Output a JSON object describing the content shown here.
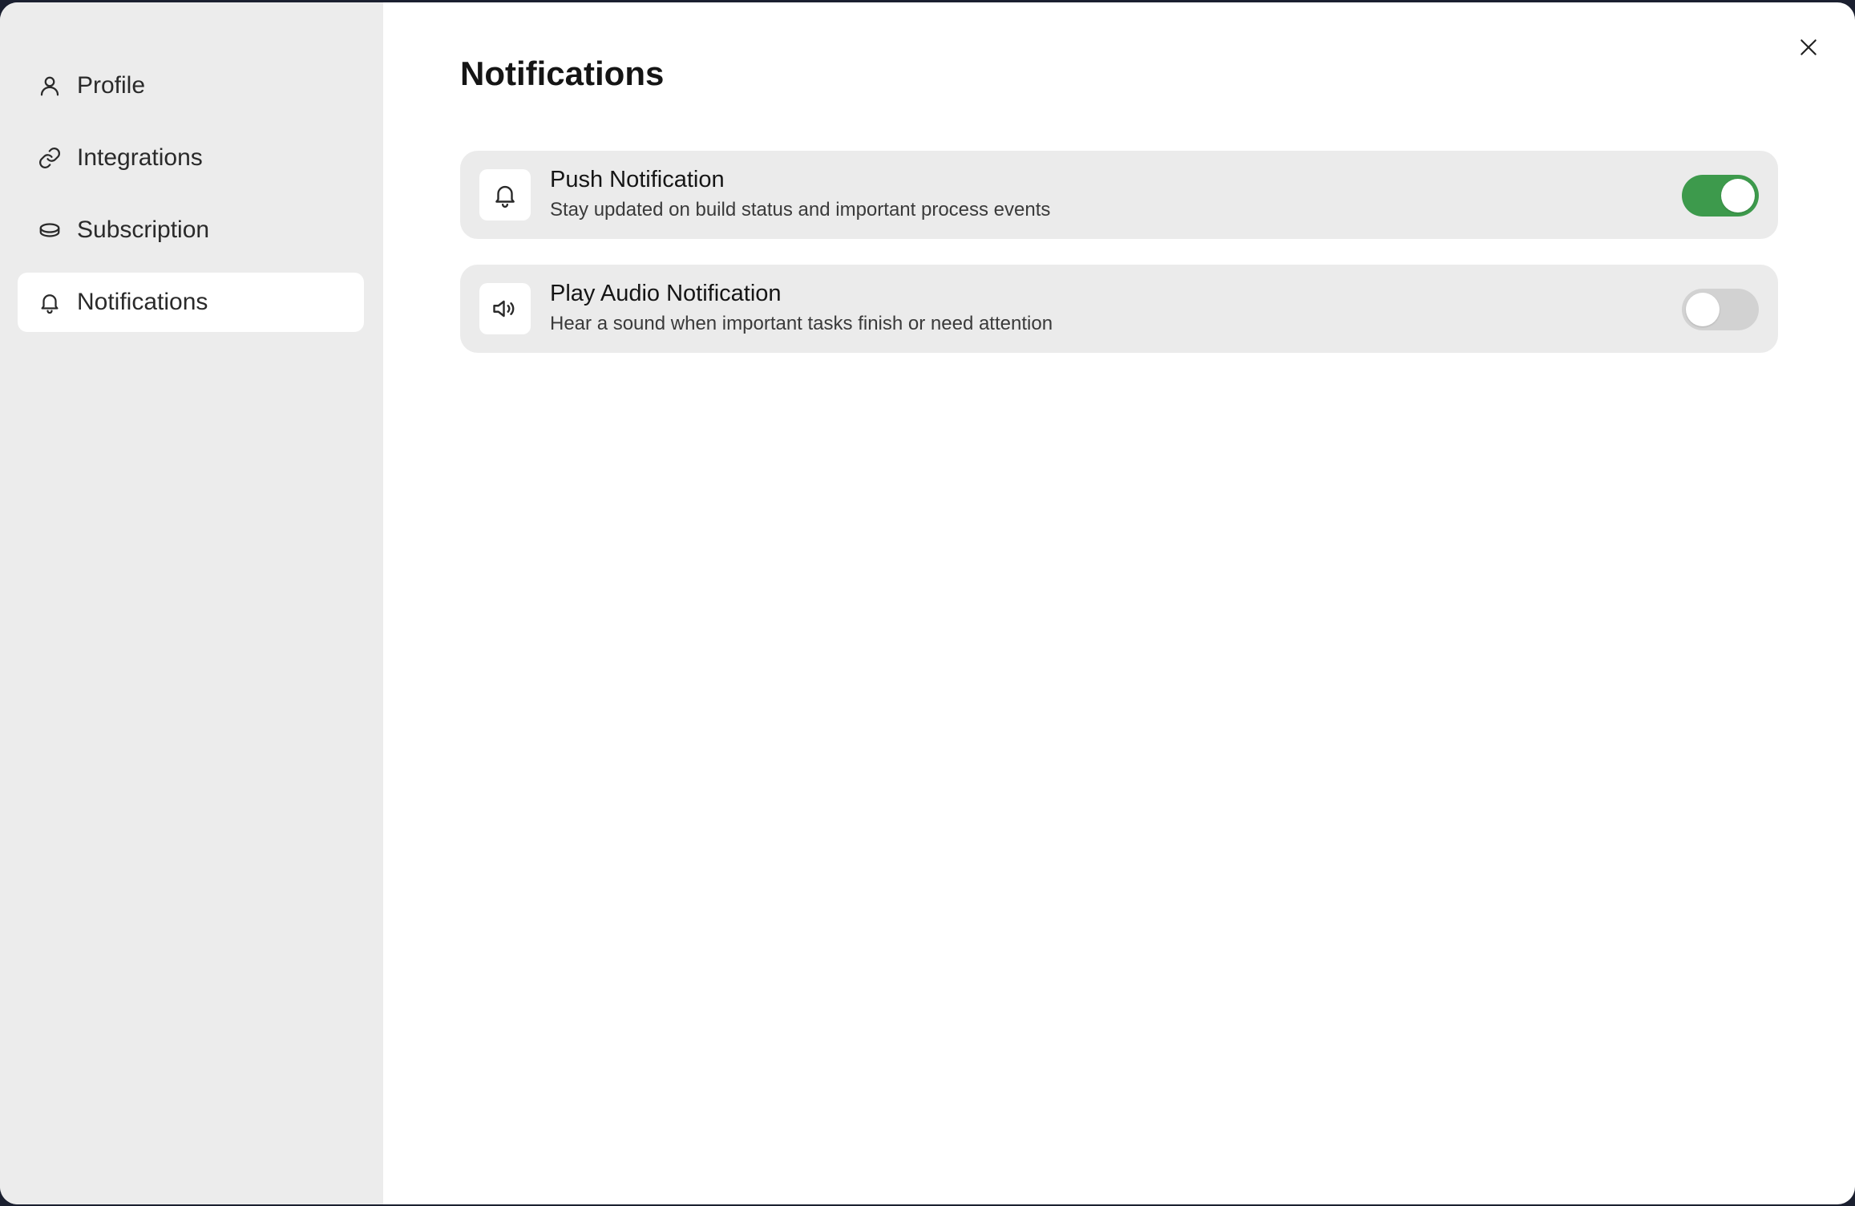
{
  "sidebar": {
    "items": [
      {
        "label": "Profile",
        "icon": "user-icon",
        "active": false
      },
      {
        "label": "Integrations",
        "icon": "link-icon",
        "active": false
      },
      {
        "label": "Subscription",
        "icon": "coin-icon",
        "active": false
      },
      {
        "label": "Notifications",
        "icon": "bell-icon",
        "active": true
      }
    ]
  },
  "header": {
    "title": "Notifications",
    "close_icon": "close-icon"
  },
  "settings": [
    {
      "title": "Push Notification",
      "description": "Stay updated on build status and important process events",
      "icon": "bell-icon",
      "enabled": true
    },
    {
      "title": "Play Audio Notification",
      "description": "Hear a sound when important tasks finish or need attention",
      "icon": "speaker-icon",
      "enabled": false
    }
  ],
  "colors": {
    "toggle_on": "#3d9a4c",
    "toggle_off": "#d2d2d2",
    "sidebar_bg": "#ececec",
    "card_bg": "#ebebeb"
  }
}
